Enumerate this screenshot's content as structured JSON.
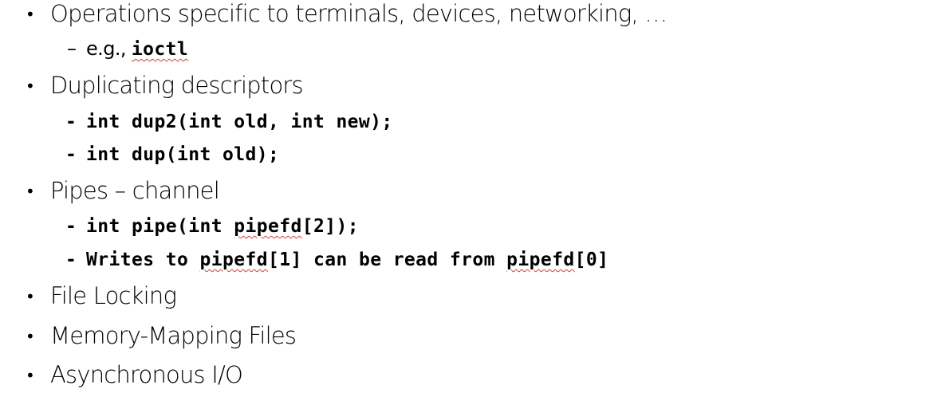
{
  "bullets": {
    "item1": {
      "text": "Operations specific to terminals, devices, networking, …",
      "sub": {
        "prefix": "e.g., ",
        "code": "ioctl"
      }
    },
    "item2": {
      "text": "Duplicating descriptors",
      "sub1": "int dup2(int old, int new);",
      "sub2": "int dup(int old);"
    },
    "item3": {
      "text": "Pipes – channel",
      "sub1": {
        "before": "int pipe(int ",
        "squiggle": "pipefd",
        "after": "[2]);"
      },
      "sub2": {
        "part1": "Writes to ",
        "squiggle1": "pipefd",
        "part2": "[1] can be read from ",
        "squiggle2": "pipefd",
        "part3": "[0]"
      }
    },
    "item4": {
      "text": "File Locking"
    },
    "item5": {
      "text": "Memory-Mapping Files"
    },
    "item6": {
      "text": "Asynchronous I/O"
    }
  },
  "symbols": {
    "bullet": "•",
    "dash": "–",
    "code_dash": "-"
  }
}
